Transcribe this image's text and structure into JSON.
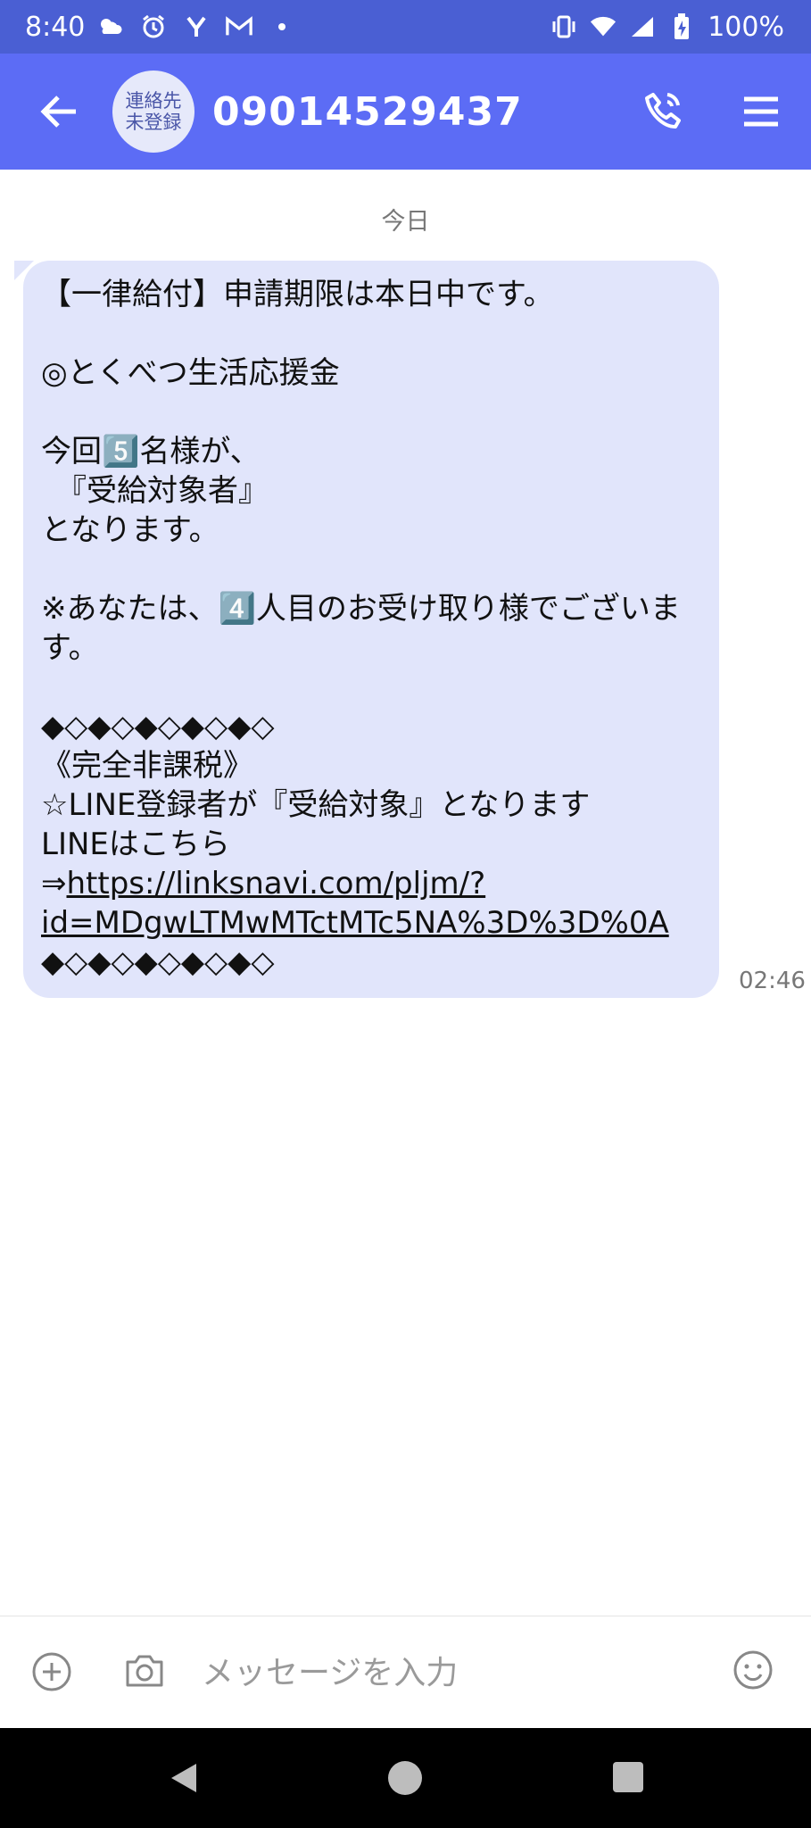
{
  "status": {
    "time": "8:40",
    "battery": "100%",
    "icons": [
      "cloudy-sun-icon",
      "alarm-icon",
      "y-icon",
      "gmail-icon",
      "dot-icon",
      "vibrate-icon",
      "wifi-icon",
      "signal-icon",
      "battery-charging-icon"
    ]
  },
  "header": {
    "avatar_line1": "連絡先",
    "avatar_line2": "未登録",
    "number": "09014529437",
    "icons": [
      "back-arrow-icon",
      "phone-call-icon",
      "menu-icon"
    ]
  },
  "chat": {
    "date_label": "今日",
    "message_part1": "【一律給付】申請期限は本日中です。\n\n◎とくべつ生活応援金\n\n今回5️⃣名様が、\n　『受給対象者』\nとなります。\n\n※あなたは、4️⃣人目のお受け取り様でございます。\n\n◆◇◆◇◆◇◆◇◆◇\n《完全非課税》\n☆LINE登録者が『受給対象』となります\nLINEはこちら\n⇒",
    "link": "https://linksnavi.com/pljm/?id=MDgwLTMwMTctMTc5NA%3D%3D%0A",
    "message_part2": "\n◆◇◆◇◆◇◆◇◆◇",
    "time": "02:46"
  },
  "composer": {
    "placeholder": "メッセージを入力",
    "icons": [
      "add-circle-icon",
      "camera-icon",
      "emoji-icon"
    ]
  },
  "navigation": {
    "icons": [
      "nav-back-icon",
      "nav-home-icon",
      "nav-recents-icon"
    ]
  },
  "colors": {
    "status_bar": "#4a5fd3",
    "app_bar": "#5c6cf5",
    "bubble": "#e1e5fb"
  }
}
